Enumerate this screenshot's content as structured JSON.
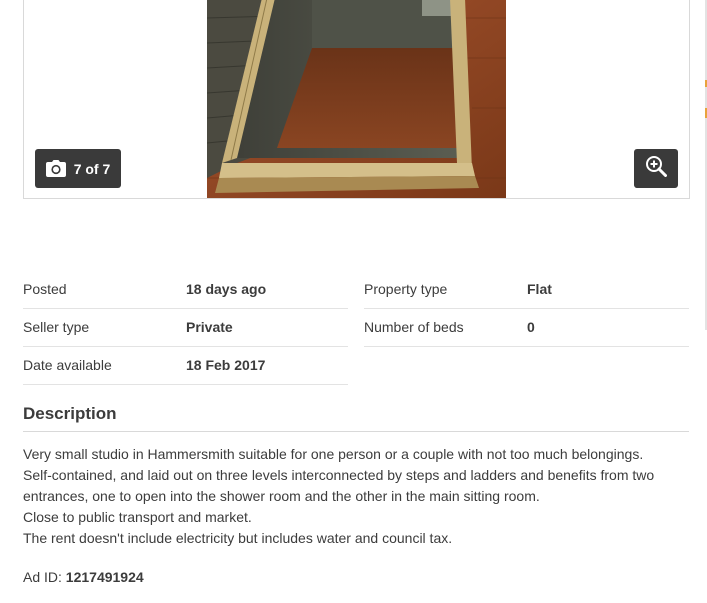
{
  "gallery": {
    "counter_label": "7 of 7",
    "camera_icon": "camera-icon",
    "zoom_icon": "zoom-in-icon"
  },
  "details": {
    "left": [
      {
        "label": "Posted",
        "value": "18 days ago"
      },
      {
        "label": "Seller type",
        "value": "Private"
      },
      {
        "label": "Date available",
        "value": "18 Feb 2017"
      }
    ],
    "right": [
      {
        "label": "Property type",
        "value": "Flat"
      },
      {
        "label": "Number of beds",
        "value": "0"
      }
    ]
  },
  "description": {
    "heading": "Description",
    "lines": [
      "Very small studio in Hammersmith suitable for one person or a couple with not too much belongings.",
      "Self-contained, and laid out on three levels interconnected by steps and ladders and benefits from two",
      "entrances, one to open into the shower room and the other in the main sitting room.",
      "Close to public transport and market.",
      "The rent doesn't include electricity but includes water and council tax."
    ]
  },
  "ad": {
    "label": "Ad ID:",
    "id": "1217491924"
  },
  "colors": {
    "button_bg": "#3a3a3a",
    "text": "#3c3c3c",
    "divider": "#e3e3e3",
    "accent": "#e8a33c"
  }
}
